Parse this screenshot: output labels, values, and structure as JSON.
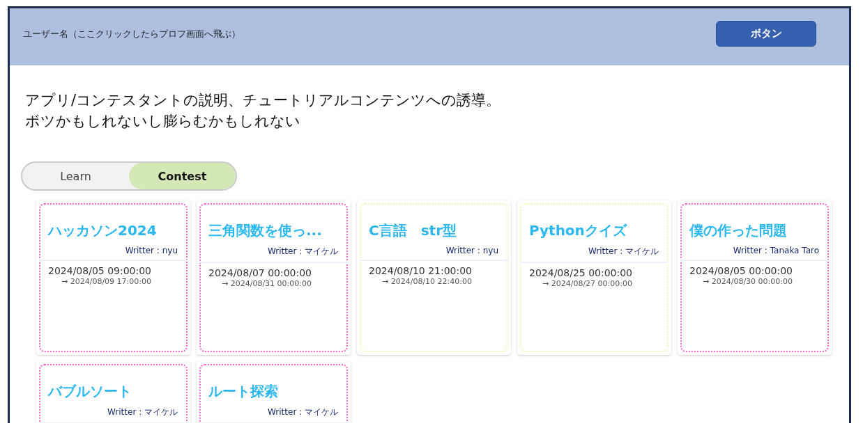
{
  "header": {
    "user_link": "ユーザー名（ここクリックしたらプロフ画面へ飛ぶ）",
    "button": "ボタン"
  },
  "intro": [
    "アプリ/コンテスタントの説明、チュートリアルコンテンツへの誘導。",
    "ボツかもしれないし膨らむかもしれない"
  ],
  "tabs": [
    {
      "label": "Learn",
      "selected": false
    },
    {
      "label": "Contest",
      "selected": true
    }
  ],
  "cards": [
    {
      "title": "ハッカソン2024",
      "writer": "Writter : nyu",
      "start": "2024/08/05  09:00:00",
      "end": "→ 2024/08/09  17:00:00",
      "color": "#ff66cc"
    },
    {
      "title": "三角関数を使っ...",
      "writer": "Writter : マイケル",
      "start": "2024/08/07  00:00:00",
      "end": "→ 2024/08/31  00:00:00",
      "color": "#ff66cc"
    },
    {
      "title": "C言語　str型",
      "writer": "Writter : nyu",
      "start": "2024/08/10  21:00:00",
      "end": "→ 2024/08/10  22:40:00",
      "color": "#f2f8c0"
    },
    {
      "title": "Pythonクイズ",
      "writer": "Writter : マイケル",
      "start": "2024/08/25  00:00:00",
      "end": "→ 2024/08/27  00:00:00",
      "color": "#f2f8c0"
    },
    {
      "title": "僕の作った問題",
      "writer": "Writter : Tanaka Taro",
      "start": "2024/08/05  00:00:00",
      "end": "→ 2024/08/30  00:00:00",
      "color": "#ff66cc"
    },
    {
      "title": "バブルソート",
      "writer": "Writter : マイケル",
      "color": "#ff66cc"
    },
    {
      "title": "ルート探索",
      "writer": "Writter : マイケル",
      "color": "#ff66cc"
    }
  ]
}
